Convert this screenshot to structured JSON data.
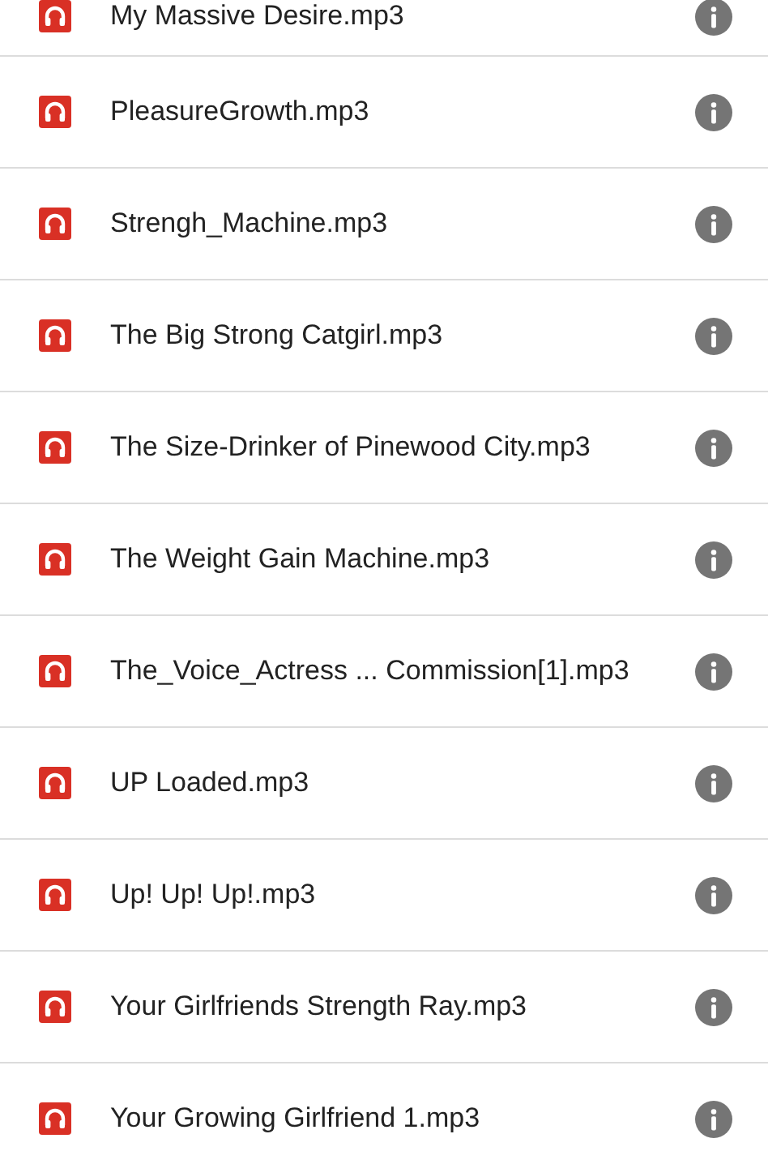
{
  "files": [
    {
      "name": "My Massive Desire.mp3"
    },
    {
      "name": "PleasureGrowth.mp3"
    },
    {
      "name": "Strengh_Machine.mp3"
    },
    {
      "name": "The Big Strong Catgirl.mp3"
    },
    {
      "name": "The Size-Drinker of Pinewood City.mp3"
    },
    {
      "name": "The Weight Gain Machine.mp3"
    },
    {
      "name": "The_Voice_Actress ... Commission[1].mp3"
    },
    {
      "name": "UP Loaded.mp3"
    },
    {
      "name": "Up! Up! Up!.mp3"
    },
    {
      "name": "Your Girlfriends Strength Ray.mp3"
    },
    {
      "name": "Your Growing Girlfriend 1.mp3"
    }
  ]
}
